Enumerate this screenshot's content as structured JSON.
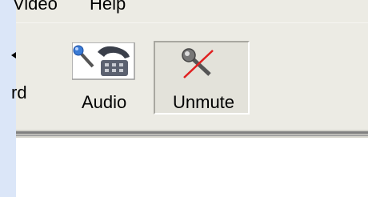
{
  "menu": {
    "items": [
      {
        "label": "Video"
      },
      {
        "label": "Help"
      }
    ]
  },
  "toolbar": {
    "buttons": [
      {
        "label": "rd",
        "icon": "arrow-icon"
      },
      {
        "label": "Audio",
        "icon": "microphone-phone-icon"
      },
      {
        "label": "Unmute",
        "icon": "muted-microphone-icon",
        "pressed": true
      }
    ]
  },
  "colors": {
    "chrome": "#ecebe4",
    "side_strip": "#dbe6f8",
    "mute_slash": "#e02020",
    "mic_blue": "#3a7bd5"
  }
}
